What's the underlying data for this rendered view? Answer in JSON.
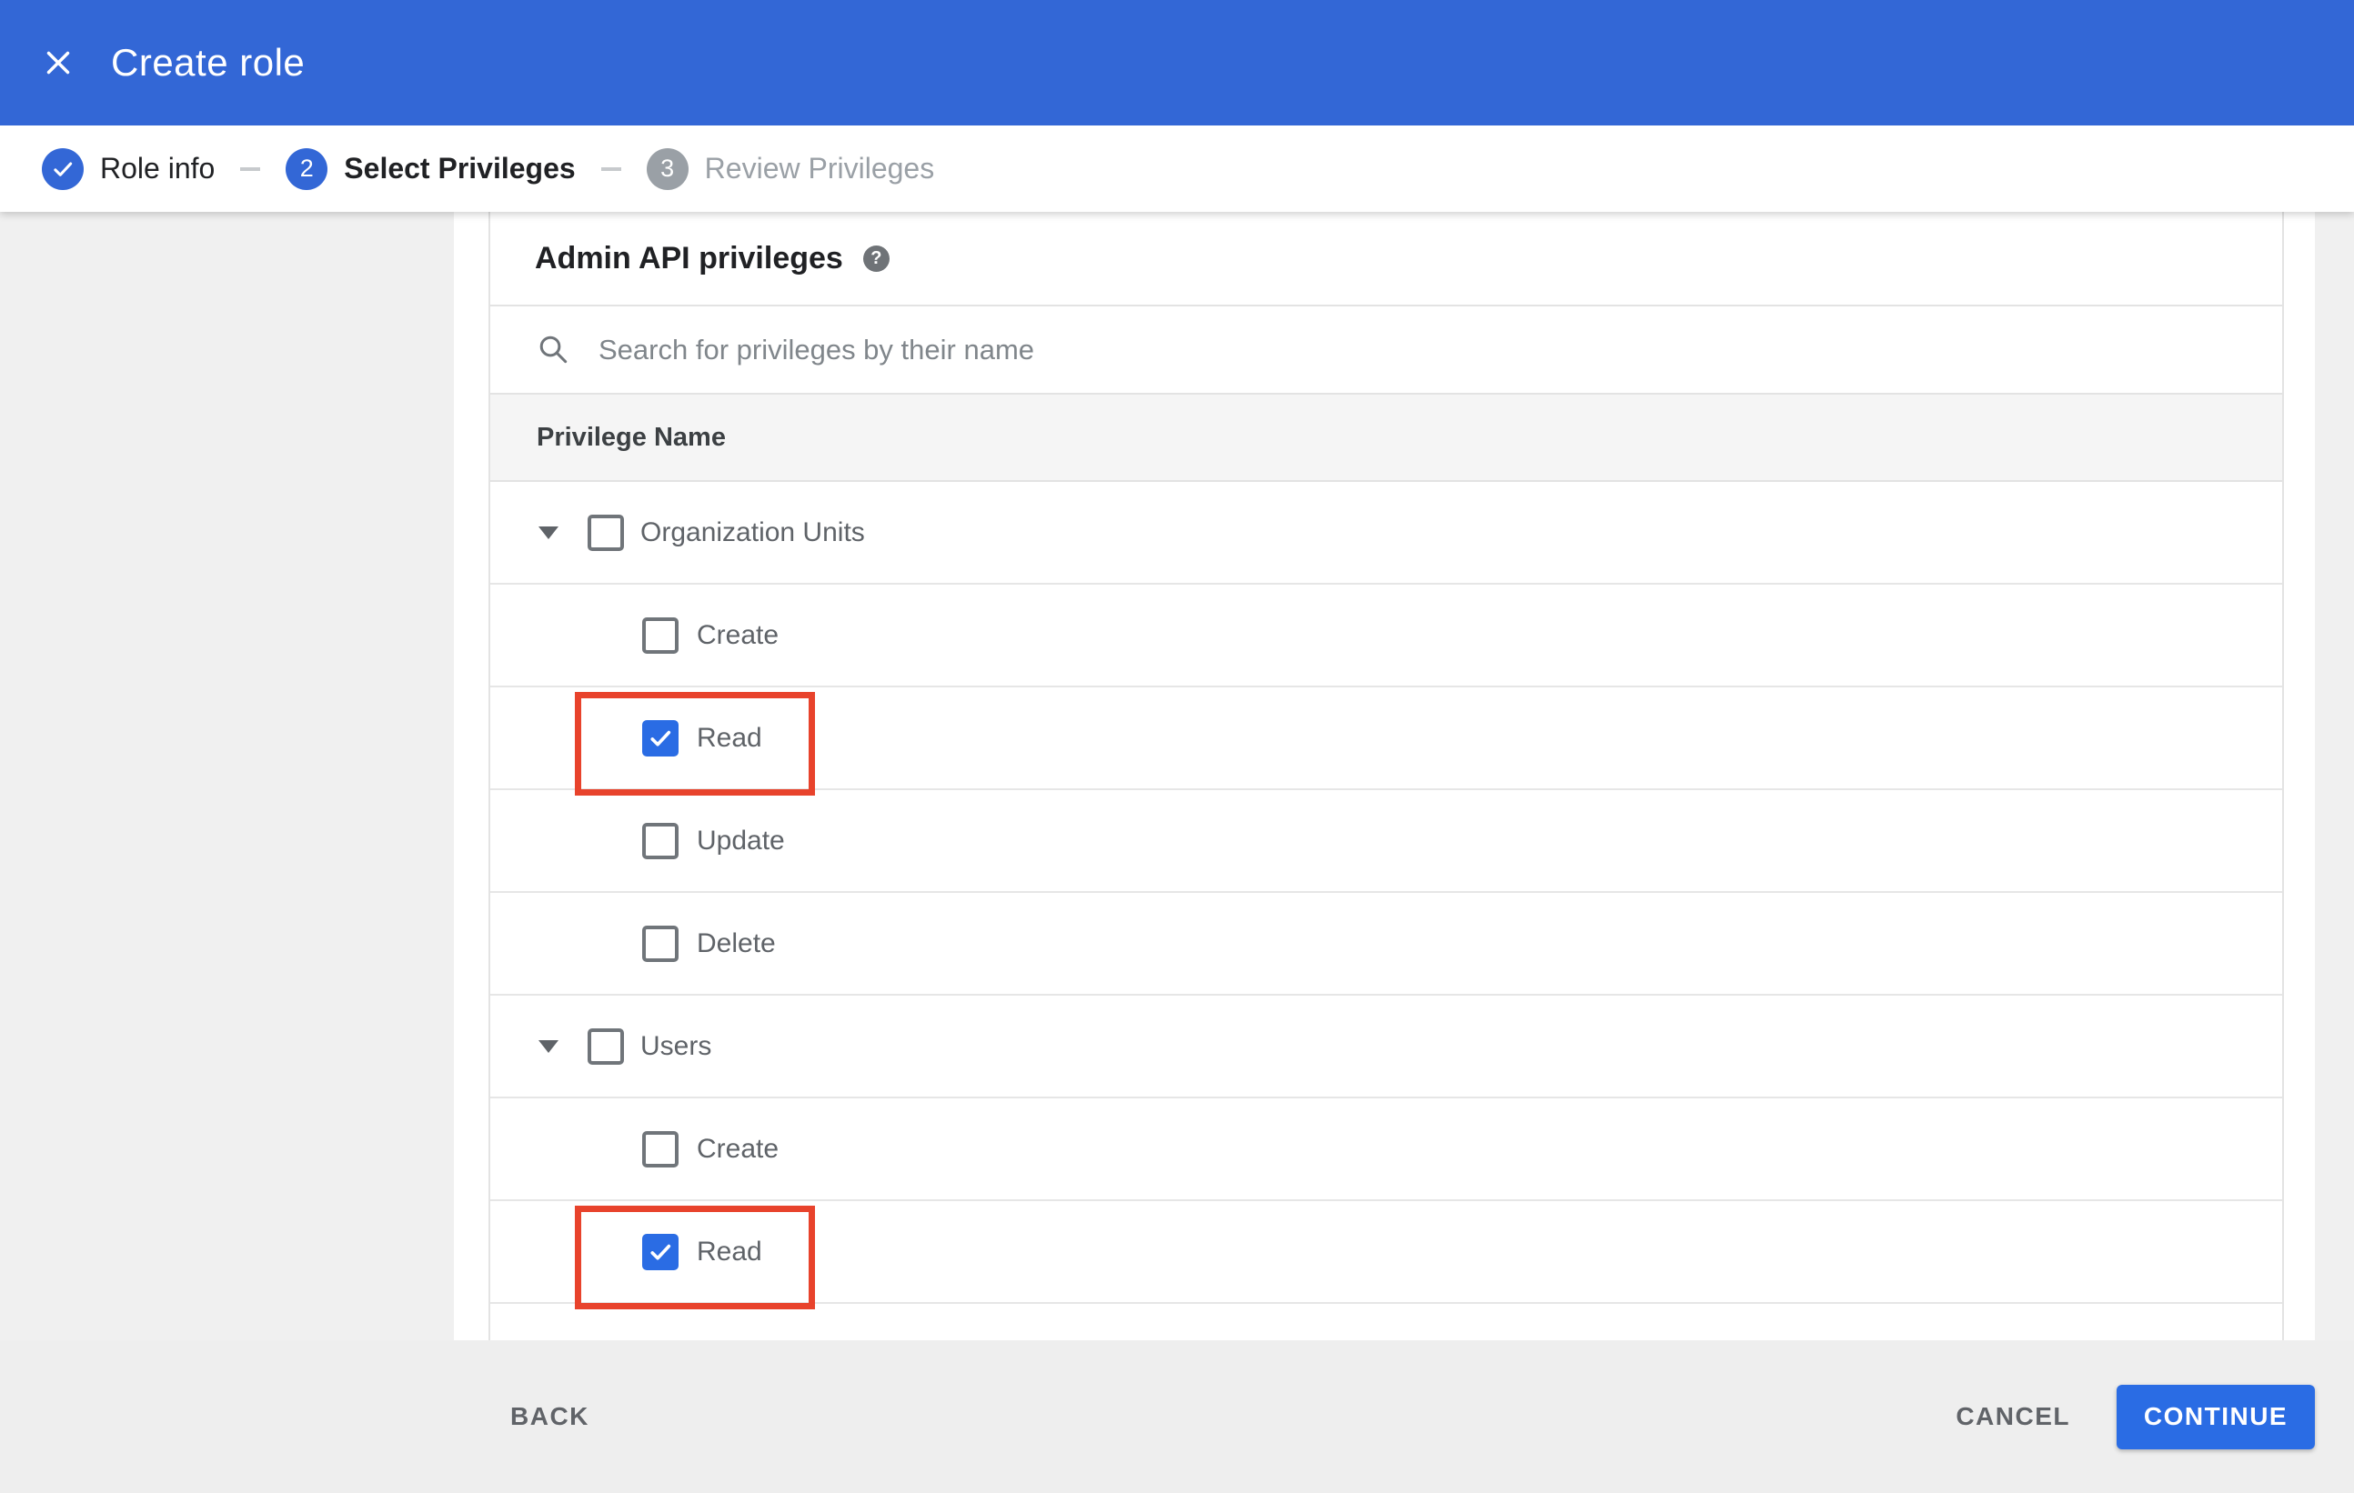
{
  "header": {
    "title": "Create role"
  },
  "stepper": {
    "steps": [
      {
        "indicator": "check",
        "label": "Role info",
        "state": "completed"
      },
      {
        "indicator": "2",
        "label": "Select Privileges",
        "state": "active"
      },
      {
        "indicator": "3",
        "label": "Review Privileges",
        "state": "upcoming"
      }
    ]
  },
  "privileges_panel": {
    "title": "Admin API privileges",
    "help_icon": "question-mark-icon",
    "search": {
      "placeholder": "Search for privileges by their name",
      "value": ""
    },
    "column_header": "Privilege Name",
    "groups": [
      {
        "label": "Organization Units",
        "checked": false,
        "expanded": true,
        "children": [
          {
            "label": "Create",
            "checked": false,
            "highlighted": false
          },
          {
            "label": "Read",
            "checked": true,
            "highlighted": true
          },
          {
            "label": "Update",
            "checked": false,
            "highlighted": false
          },
          {
            "label": "Delete",
            "checked": false,
            "highlighted": false
          }
        ]
      },
      {
        "label": "Users",
        "checked": false,
        "expanded": true,
        "children": [
          {
            "label": "Create",
            "checked": false,
            "highlighted": false
          },
          {
            "label": "Read",
            "checked": true,
            "highlighted": true
          }
        ]
      }
    ]
  },
  "footer": {
    "back_label": "BACK",
    "cancel_label": "CANCEL",
    "continue_label": "CONTINUE"
  },
  "colors": {
    "primary_blue": "#3367d6",
    "control_blue": "#2a6ce4",
    "highlight_red": "#e8432c",
    "inactive_grey": "#9aa0a6",
    "page_bg": "#f0f0f0",
    "footer_bg": "#eeeeee",
    "header_row_bg": "#f5f5f5",
    "border": "#e3e3e3",
    "text_dark": "#202124",
    "text_grey": "#5f6368",
    "placeholder_grey": "#80868b",
    "icon_grey": "#6f7377"
  }
}
